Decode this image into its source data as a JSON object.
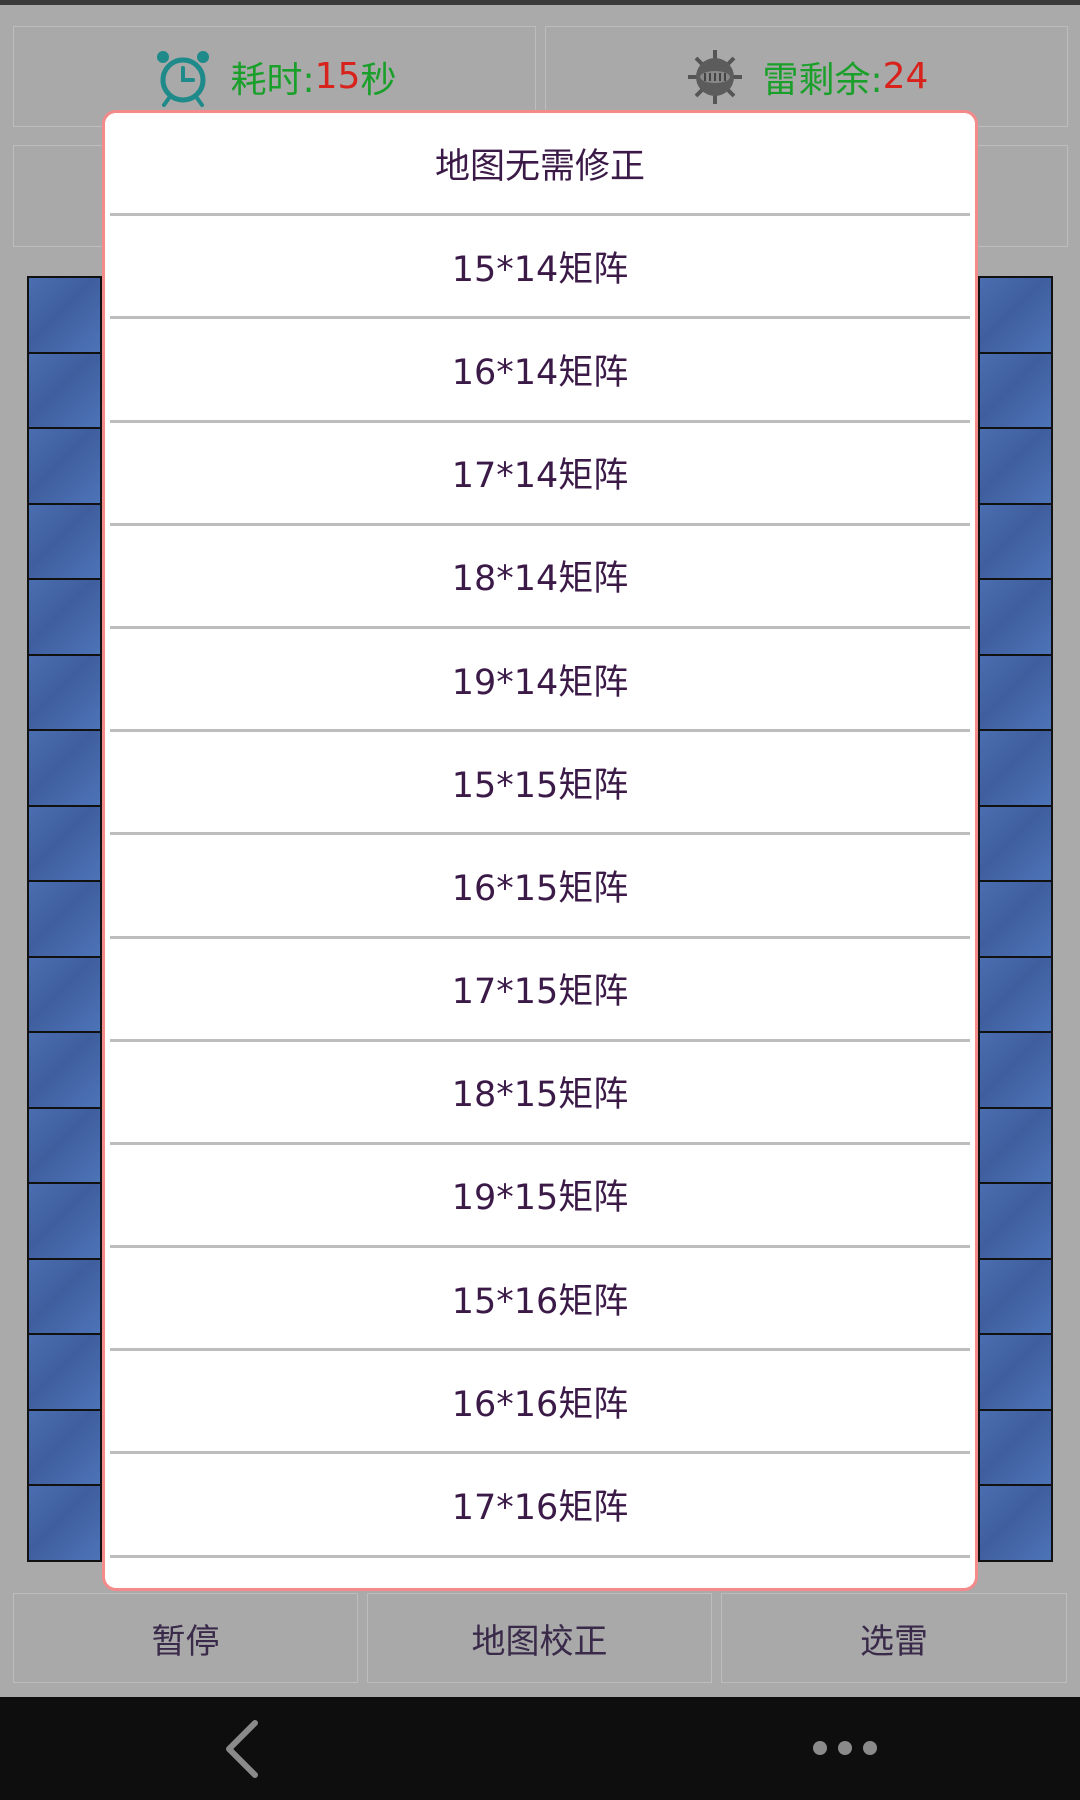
{
  "header": {
    "timer": {
      "icon": "alarm-clock-icon",
      "label": "耗时:",
      "value": "15",
      "unit": "秒"
    },
    "mines": {
      "icon": "mine-icon",
      "label": "雷剩余:",
      "value": "24"
    }
  },
  "board": {
    "visible_rows": 17,
    "visible_cols": 14
  },
  "dialog": {
    "items": [
      "地图无需修正",
      "15*14矩阵",
      "16*14矩阵",
      "17*14矩阵",
      "18*14矩阵",
      "19*14矩阵",
      "15*15矩阵",
      "16*15矩阵",
      "17*15矩阵",
      "18*15矩阵",
      "19*15矩阵",
      "15*16矩阵",
      "16*16矩阵",
      "17*16矩阵",
      ""
    ]
  },
  "bottom": {
    "pause_label": "暂停",
    "calibrate_label": "地图校正",
    "select_label": "选雷"
  },
  "navbar": {
    "back_icon": "back-chevron-icon",
    "more_icon": "more-dots-icon"
  },
  "colors": {
    "accent_green": "#1aa02a",
    "accent_red": "#d8231c",
    "dialog_border": "#f48a8a",
    "cell_blue": "#4a6eb0"
  }
}
